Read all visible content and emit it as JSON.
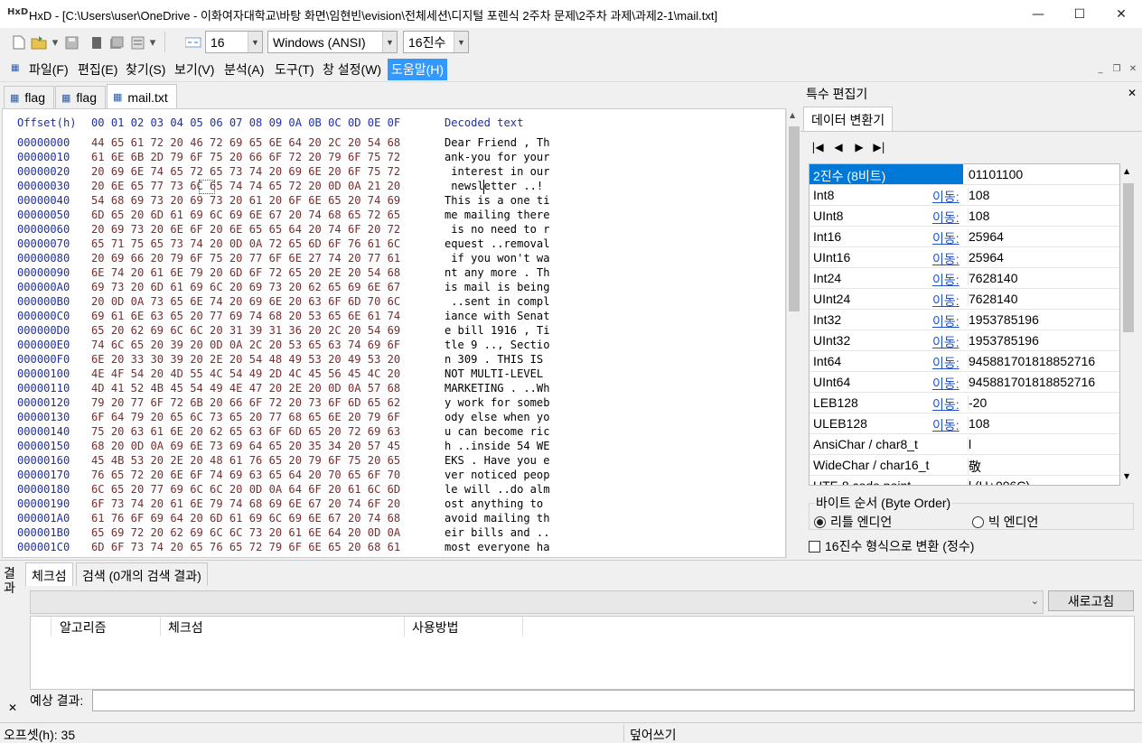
{
  "window": {
    "app_icon": "HxD",
    "title": "HxD - [C:\\Users\\user\\OneDrive - 이화여자대학교\\바탕 화면\\임현빈\\evision\\전체세션\\디지털 포렌식 2주차 문제\\2주차 과제\\과제2-1\\mail.txt]",
    "minimize": "—",
    "maximize": "☐",
    "close": "✕"
  },
  "toolbar": {
    "bytes_per_row": "16",
    "charset": "Windows (ANSI)",
    "offset_base": "16진수"
  },
  "menu": [
    {
      "label": "파일(F)"
    },
    {
      "label": "편집(E)"
    },
    {
      "label": "찾기(S)"
    },
    {
      "label": "보기(V)"
    },
    {
      "label": "분석(A)"
    },
    {
      "label": "도구(T)"
    },
    {
      "label": "창 설정(W)"
    },
    {
      "label": "도움말(H)"
    }
  ],
  "mdi": {
    "min": "_",
    "restore": "❐",
    "close": "✕"
  },
  "tabs": [
    {
      "label": "flag"
    },
    {
      "label": "flag"
    },
    {
      "label": "mail.txt"
    }
  ],
  "hex": {
    "header_offset": "Offset(h)",
    "header_bytes": "00 01 02 03 04 05 06 07 08 09 0A 0B 0C 0D 0E 0F",
    "header_text": "Decoded text",
    "rows": [
      {
        "off": "00000000",
        "bytes": "44 65 61 72 20 46 72 69 65 6E 64 20 2C 20 54 68",
        "text": "Dear Friend , Th"
      },
      {
        "off": "00000010",
        "bytes": "61 6E 6B 2D 79 6F 75 20 66 6F 72 20 79 6F 75 72",
        "text": "ank-you for your"
      },
      {
        "off": "00000020",
        "bytes": "20 69 6E 74 65 72 65 73 74 20 69 6E 20 6F 75 72",
        "text": " interest in our"
      },
      {
        "off": "00000030",
        "bytes": "20 6E 65 77 73 6C 65 74 74 65 72 20 0D 0A 21 20",
        "text": " newsletter ..! "
      },
      {
        "off": "00000040",
        "bytes": "54 68 69 73 20 69 73 20 61 20 6F 6E 65 20 74 69",
        "text": "This is a one ti"
      },
      {
        "off": "00000050",
        "bytes": "6D 65 20 6D 61 69 6C 69 6E 67 20 74 68 65 72 65",
        "text": "me mailing there"
      },
      {
        "off": "00000060",
        "bytes": "20 69 73 20 6E 6F 20 6E 65 65 64 20 74 6F 20 72",
        "text": " is no need to r"
      },
      {
        "off": "00000070",
        "bytes": "65 71 75 65 73 74 20 0D 0A 72 65 6D 6F 76 61 6C",
        "text": "equest ..removal"
      },
      {
        "off": "00000080",
        "bytes": "20 69 66 20 79 6F 75 20 77 6F 6E 27 74 20 77 61",
        "text": " if you won't wa"
      },
      {
        "off": "00000090",
        "bytes": "6E 74 20 61 6E 79 20 6D 6F 72 65 20 2E 20 54 68",
        "text": "nt any more . Th"
      },
      {
        "off": "000000A0",
        "bytes": "69 73 20 6D 61 69 6C 20 69 73 20 62 65 69 6E 67",
        "text": "is mail is being"
      },
      {
        "off": "000000B0",
        "bytes": "20 0D 0A 73 65 6E 74 20 69 6E 20 63 6F 6D 70 6C",
        "text": " ..sent in compl"
      },
      {
        "off": "000000C0",
        "bytes": "69 61 6E 63 65 20 77 69 74 68 20 53 65 6E 61 74",
        "text": "iance with Senat"
      },
      {
        "off": "000000D0",
        "bytes": "65 20 62 69 6C 6C 20 31 39 31 36 20 2C 20 54 69",
        "text": "e bill 1916 , Ti"
      },
      {
        "off": "000000E0",
        "bytes": "74 6C 65 20 39 20 0D 0A 2C 20 53 65 63 74 69 6F",
        "text": "tle 9 .., Sectio"
      },
      {
        "off": "000000F0",
        "bytes": "6E 20 33 30 39 20 2E 20 54 48 49 53 20 49 53 20",
        "text": "n 309 . THIS IS "
      },
      {
        "off": "00000100",
        "bytes": "4E 4F 54 20 4D 55 4C 54 49 2D 4C 45 56 45 4C 20",
        "text": "NOT MULTI-LEVEL "
      },
      {
        "off": "00000110",
        "bytes": "4D 41 52 4B 45 54 49 4E 47 20 2E 20 0D 0A 57 68",
        "text": "MARKETING . ..Wh"
      },
      {
        "off": "00000120",
        "bytes": "79 20 77 6F 72 6B 20 66 6F 72 20 73 6F 6D 65 62",
        "text": "y work for someb"
      },
      {
        "off": "00000130",
        "bytes": "6F 64 79 20 65 6C 73 65 20 77 68 65 6E 20 79 6F",
        "text": "ody else when yo"
      },
      {
        "off": "00000140",
        "bytes": "75 20 63 61 6E 20 62 65 63 6F 6D 65 20 72 69 63",
        "text": "u can become ric"
      },
      {
        "off": "00000150",
        "bytes": "68 20 0D 0A 69 6E 73 69 64 65 20 35 34 20 57 45",
        "text": "h ..inside 54 WE"
      },
      {
        "off": "00000160",
        "bytes": "45 4B 53 20 2E 20 48 61 76 65 20 79 6F 75 20 65",
        "text": "EKS . Have you e"
      },
      {
        "off": "00000170",
        "bytes": "76 65 72 20 6E 6F 74 69 63 65 64 20 70 65 6F 70",
        "text": "ver noticed peop"
      },
      {
        "off": "00000180",
        "bytes": "6C 65 20 77 69 6C 6C 20 0D 0A 64 6F 20 61 6C 6D",
        "text": "le will ..do alm"
      },
      {
        "off": "00000190",
        "bytes": "6F 73 74 20 61 6E 79 74 68 69 6E 67 20 74 6F 20",
        "text": "ost anything to "
      },
      {
        "off": "000001A0",
        "bytes": "61 76 6F 69 64 20 6D 61 69 6C 69 6E 67 20 74 68",
        "text": "avoid mailing th"
      },
      {
        "off": "000001B0",
        "bytes": "65 69 72 20 62 69 6C 6C 73 20 61 6E 64 20 0D 0A",
        "text": "eir bills and .."
      },
      {
        "off": "000001C0",
        "bytes": "6D 6F 73 74 20 65 76 65 72 79 6F 6E 65 20 68 61",
        "text": "most everyone ha"
      }
    ]
  },
  "special_editor": {
    "title": "특수 편집기",
    "close": "✕",
    "tab": "데이터 변환기",
    "nav": [
      "|◀",
      "◀",
      "▶",
      "▶|"
    ],
    "rows": [
      {
        "name": "2진수 (8비트)",
        "link": "",
        "value": "01101100"
      },
      {
        "name": "Int8",
        "link": "이동:",
        "value": "108"
      },
      {
        "name": "UInt8",
        "link": "이동:",
        "value": "108"
      },
      {
        "name": "Int16",
        "link": "이동:",
        "value": "25964"
      },
      {
        "name": "UInt16",
        "link": "이동:",
        "value": "25964"
      },
      {
        "name": "Int24",
        "link": "이동:",
        "value": "7628140"
      },
      {
        "name": "UInt24",
        "link": "이동:",
        "value": "7628140"
      },
      {
        "name": "Int32",
        "link": "이동:",
        "value": "1953785196"
      },
      {
        "name": "UInt32",
        "link": "이동:",
        "value": "1953785196"
      },
      {
        "name": "Int64",
        "link": "이동:",
        "value": "945881701818852716"
      },
      {
        "name": "UInt64",
        "link": "이동:",
        "value": "945881701818852716"
      },
      {
        "name": "LEB128",
        "link": "이동:",
        "value": "-20"
      },
      {
        "name": "ULEB128",
        "link": "이동:",
        "value": "108"
      },
      {
        "name": "AnsiChar / char8_t",
        "link": "",
        "value": "l"
      },
      {
        "name": "WideChar / char16_t",
        "link": "",
        "value": "敬"
      },
      {
        "name": "UTF-8 code point",
        "link": "",
        "value": "l (U+006C)"
      }
    ],
    "byte_order_label": "바이트 순서 (Byte Order)",
    "little_endian": "리틀 엔디언",
    "big_endian": "빅 엔디언",
    "hex_format": "16진수 형식으로 변환 (정수)"
  },
  "results": {
    "panel_label": "결과",
    "close": "✕",
    "tab_checksum": "체크섬",
    "tab_search": "검색 (0개의 검색 결과)",
    "refresh": "새로고침",
    "col_algorithm": "알고리즘",
    "col_checksum": "체크섬",
    "col_usage": "사용방법",
    "expected_label": "예상 결과:"
  },
  "status": {
    "offset": "오프셋(h): 35",
    "mode": "덮어쓰기"
  }
}
